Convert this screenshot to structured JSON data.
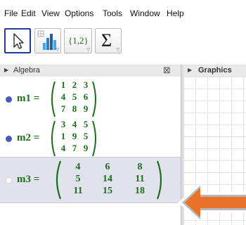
{
  "menu": [
    "File",
    "Edit",
    "View",
    "Options",
    "Tools",
    "Window",
    "Help"
  ],
  "toolbar": {
    "tools": [
      {
        "name": "move-tool",
        "icon": "cursor-arrow-icon",
        "selected": true
      },
      {
        "name": "bar-chart-tool",
        "icon": "bar-chart-icon",
        "selected": false
      },
      {
        "name": "list-tool",
        "icon": "list-braces-icon",
        "label": "{1,2}",
        "selected": false
      },
      {
        "name": "sum-tool",
        "icon": "sigma-icon",
        "label": "Σ",
        "selected": false
      }
    ]
  },
  "algebra": {
    "title": "Algebra",
    "objects": [
      {
        "label": "m1",
        "equals": "=",
        "matrix": [
          [
            "1",
            "2",
            "3"
          ],
          [
            "4",
            "5",
            "6"
          ],
          [
            "7",
            "8",
            "9"
          ]
        ],
        "visible": true
      },
      {
        "label": "m2",
        "equals": "=",
        "matrix": [
          [
            "3",
            "4",
            "5"
          ],
          [
            "1",
            "9",
            "5"
          ],
          [
            "4",
            "7",
            "9"
          ]
        ],
        "visible": true
      },
      {
        "label": "m3",
        "equals": "=",
        "matrix": [
          [
            "4",
            "6",
            "8"
          ],
          [
            "5",
            "14",
            "11"
          ],
          [
            "11",
            "15",
            "18"
          ]
        ],
        "visible": false,
        "selected": true
      }
    ]
  },
  "graphics": {
    "title": "Graphics"
  },
  "colors": {
    "object_text": "#1a6e1a",
    "point_blue": "#4a56c4",
    "selected_row": "#e2e2ee",
    "arrow": "#e8742a",
    "tool_selected_border": "#1f3f9a"
  }
}
